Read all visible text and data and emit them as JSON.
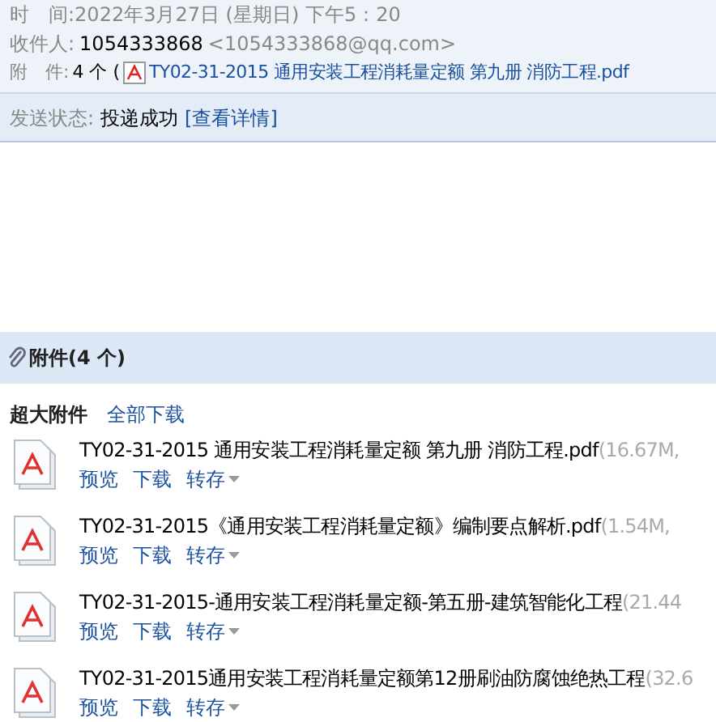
{
  "header": {
    "time_label": "时　间:",
    "time": "2022年3月27日 (星期日) 下午5：20",
    "to_label": "收件人:",
    "to_name": "1054333868",
    "to_addr": "<1054333868@qq.com>",
    "att_label": "附　件:",
    "att_count": "4 个 (",
    "att_file": "TY02-31-2015 通用安装工程消耗量定额 第九册 消防工程.pdf"
  },
  "status": {
    "label": "发送状态:",
    "value": "投递成功",
    "link": "[查看详情]"
  },
  "attachments": {
    "title": "附件(4 个)",
    "group": "超大附件",
    "download_all": "全部下载",
    "files": [
      {
        "name": "TY02-31-2015 通用安装工程消耗量定额 第九册 消防工程.pdf",
        "meta": "(16.67M,",
        "actions": [
          "预览",
          "下载",
          "转存"
        ]
      },
      {
        "name": "TY02-31-2015《通用安装工程消耗量定额》编制要点解析.pdf",
        "meta": "(1.54M,",
        "actions": [
          "预览",
          "下载",
          "转存"
        ]
      },
      {
        "name": "TY02-31-2015-通用安装工程消耗量定额-第五册-建筑智能化工程",
        "meta": "(21.44",
        "actions": [
          "预览",
          "下载",
          "转存"
        ]
      },
      {
        "name": "TY02-31-2015通用安装工程消耗量定额第12册刷油防腐蚀绝热工程",
        "meta": "(32.6",
        "actions": [
          "预览",
          "下载",
          "转存"
        ]
      }
    ]
  }
}
